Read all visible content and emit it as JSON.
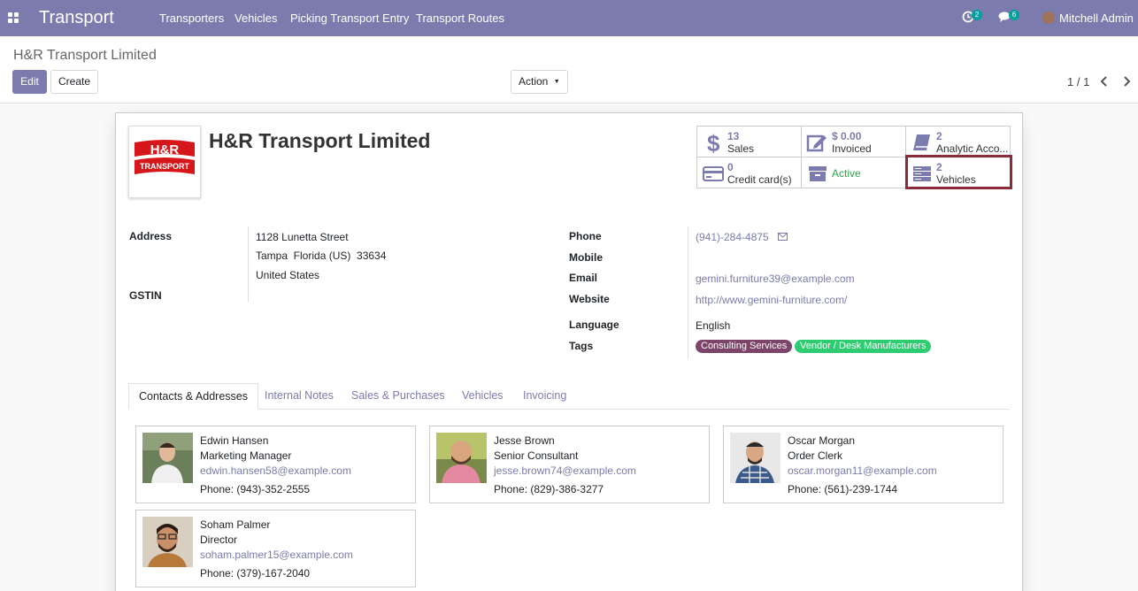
{
  "navbar": {
    "app_title": "Transport",
    "menu": [
      "Transporters",
      "Vehicles",
      "Picking Transport Entry",
      "Transport Routes"
    ],
    "activity_count": "2",
    "message_count": "6",
    "user": "Mitchell Admin"
  },
  "control": {
    "breadcrumb": "H&R Transport Limited",
    "edit_label": "Edit",
    "create_label": "Create",
    "action_label": "Action",
    "pager": "1 / 1"
  },
  "record": {
    "name": "H&R Transport Limited",
    "logo_text_top": "H&R",
    "logo_text_bottom": "TRANSPORT",
    "smart_buttons": {
      "sales": {
        "value": "13",
        "label": "Sales"
      },
      "invoiced": {
        "value": "$ 0.00",
        "label": "Invoiced"
      },
      "analytic": {
        "value": "2",
        "label": "Analytic Acco..."
      },
      "credit": {
        "value": "0",
        "label": "Credit card(s)"
      },
      "active": {
        "label": "Active"
      },
      "vehicles": {
        "value": "2",
        "label": "Vehicles"
      }
    },
    "labels": {
      "address": "Address",
      "gstin": "GSTIN",
      "phone": "Phone",
      "mobile": "Mobile",
      "email": "Email",
      "website": "Website",
      "language": "Language",
      "tags": "Tags"
    },
    "address": {
      "street": "1128 Lunetta Street",
      "city_line": "Tampa  Florida (US)  33634",
      "country": "United States"
    },
    "phone": "(941)-284-4875",
    "email": "gemini.furniture39@example.com",
    "website": "http://www.gemini-furniture.com/",
    "language": "English",
    "tags": [
      {
        "label": "Consulting Services",
        "color": "#7b4468"
      },
      {
        "label": "Vendor / Desk Manufacturers",
        "color": "#2ecc71"
      }
    ]
  },
  "tabs": [
    "Contacts & Addresses",
    "Internal Notes",
    "Sales & Purchases",
    "Vehicles",
    "Invoicing"
  ],
  "contacts": [
    {
      "name": "Edwin Hansen",
      "role": "Marketing Manager",
      "email": "edwin.hansen58@example.com",
      "phone": "Phone: (943)-352-2555"
    },
    {
      "name": "Jesse Brown",
      "role": "Senior Consultant",
      "email": "jesse.brown74@example.com",
      "phone": "Phone: (829)-386-3277"
    },
    {
      "name": "Oscar Morgan",
      "role": "Order Clerk",
      "email": "oscar.morgan11@example.com",
      "phone": "Phone: (561)-239-1744"
    },
    {
      "name": "Soham Palmer",
      "role": "Director",
      "email": "soham.palmer15@example.com",
      "phone": "Phone: (379)-167-2040"
    }
  ],
  "colors": {
    "brand": "#7c7bad",
    "highlight": "#8b2c3a",
    "active": "#28a745"
  }
}
